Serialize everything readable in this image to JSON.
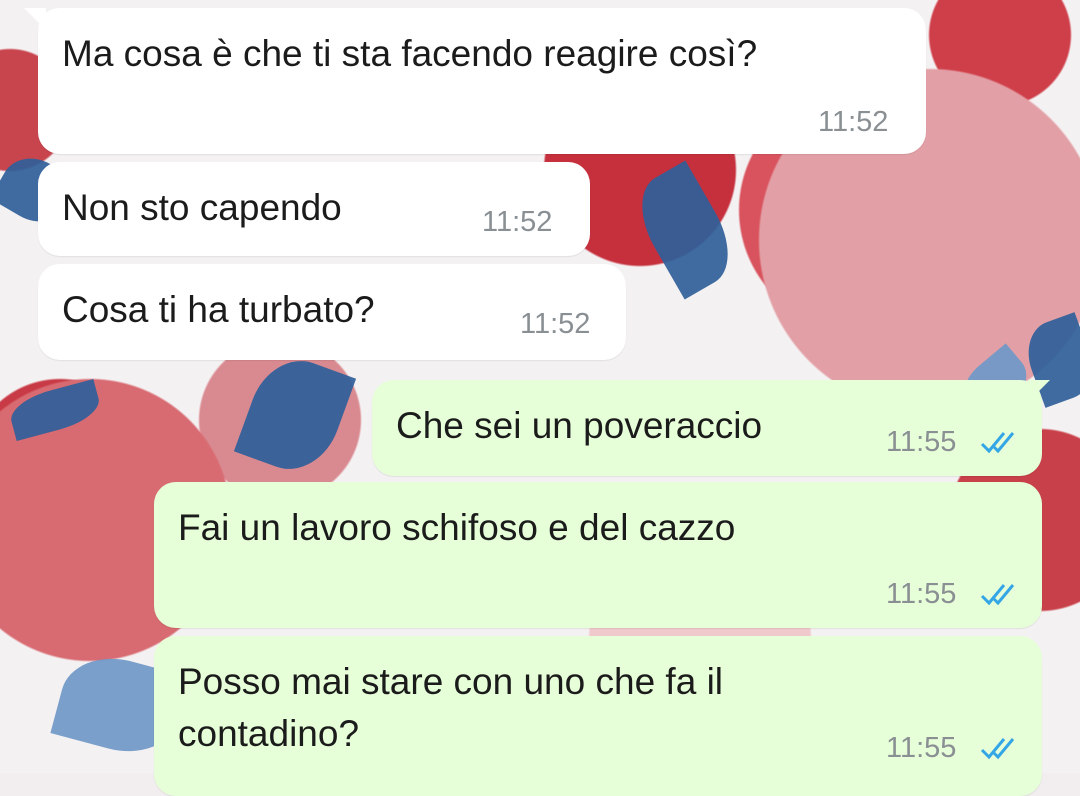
{
  "messages": [
    {
      "direction": "incoming",
      "text": "Ma cosa è che ti sta facendo reagire così?",
      "time": "11:52"
    },
    {
      "direction": "incoming",
      "text": "Non sto capendo",
      "time": "11:52"
    },
    {
      "direction": "incoming",
      "text": "Cosa ti ha turbato?",
      "time": "11:52"
    },
    {
      "direction": "outgoing",
      "text": "Che sei un poveraccio",
      "time": "11:55",
      "status": "read"
    },
    {
      "direction": "outgoing",
      "text": "Fai un lavoro schifoso e del cazzo",
      "time": "11:55",
      "status": "read"
    },
    {
      "direction": "outgoing",
      "text_line1": "Posso mai stare con uno che fa il",
      "text_line2": "contadino?",
      "time": "11:55",
      "status": "read"
    }
  ],
  "colors": {
    "incoming_bubble": "#ffffff",
    "outgoing_bubble": "#e6ffd8",
    "time_text": "#8a8f93",
    "read_tick": "#34a6e6"
  },
  "icons": {
    "read_receipt": "double-check-icon"
  }
}
